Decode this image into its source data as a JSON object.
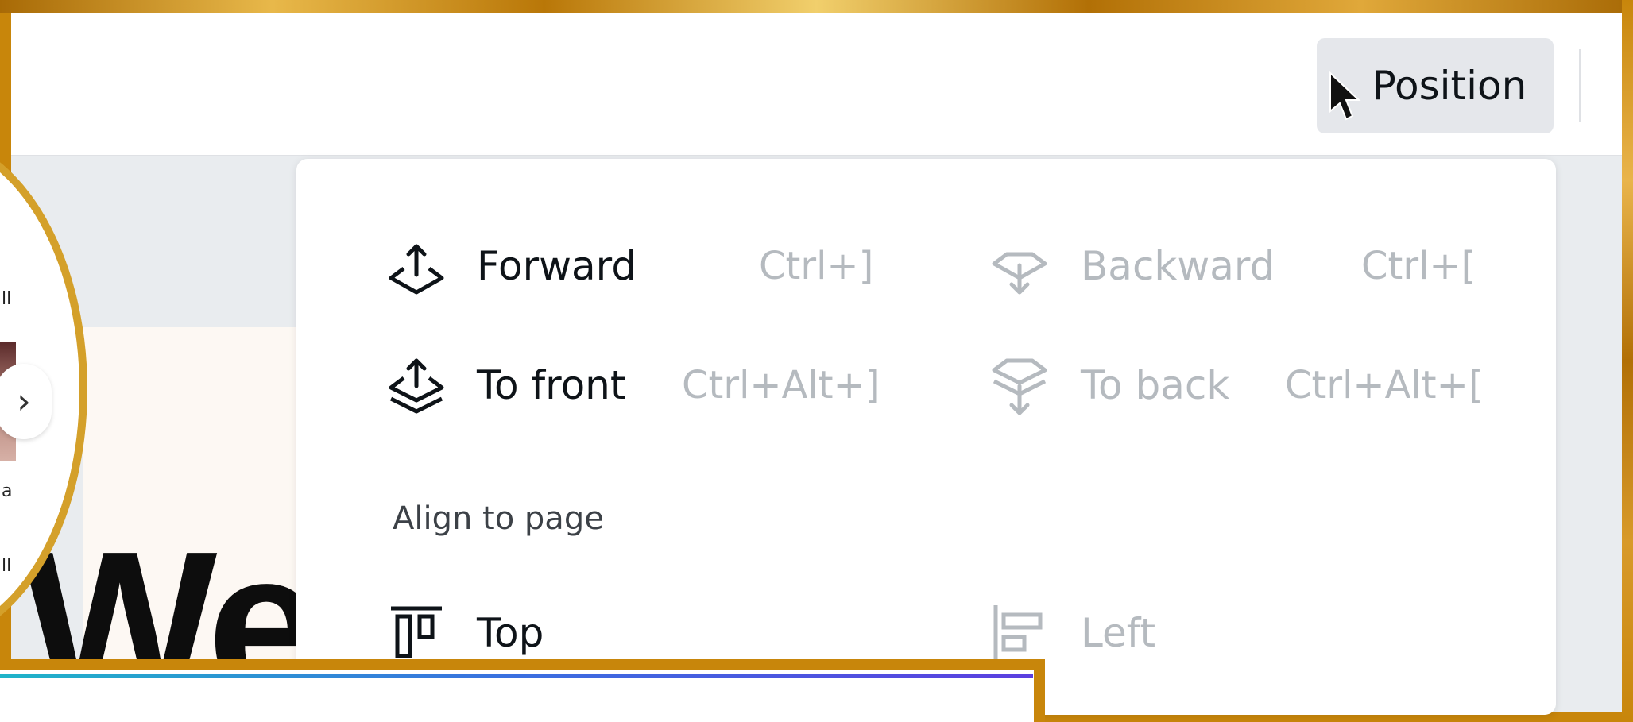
{
  "toolbar": {
    "position_label": "Position"
  },
  "menu": {
    "items": [
      {
        "label": "Forward",
        "shortcut": "Ctrl+]",
        "enabled": true,
        "icon": "forward-layer-icon"
      },
      {
        "label": "Backward",
        "shortcut": "Ctrl+[",
        "enabled": false,
        "icon": "backward-layer-icon"
      },
      {
        "label": "To front",
        "shortcut": "Ctrl+Alt+]",
        "enabled": true,
        "icon": "to-front-layer-icon"
      },
      {
        "label": "To back",
        "shortcut": "Ctrl+Alt+[",
        "enabled": false,
        "icon": "to-back-layer-icon"
      }
    ],
    "align_section_label": "Align to page",
    "align_items": [
      {
        "label": "Top",
        "enabled": true,
        "icon": "align-top-icon"
      },
      {
        "label": "Left",
        "enabled": false,
        "icon": "align-left-icon"
      }
    ]
  },
  "canvas": {
    "big_text": "We"
  },
  "lens": {
    "arrow": "›",
    "labels": [
      "ll",
      "a",
      "ll"
    ]
  },
  "colors": {
    "frame_gold": "#c8860b",
    "text_dark": "#0e1318",
    "text_disabled": "#b5babf"
  }
}
